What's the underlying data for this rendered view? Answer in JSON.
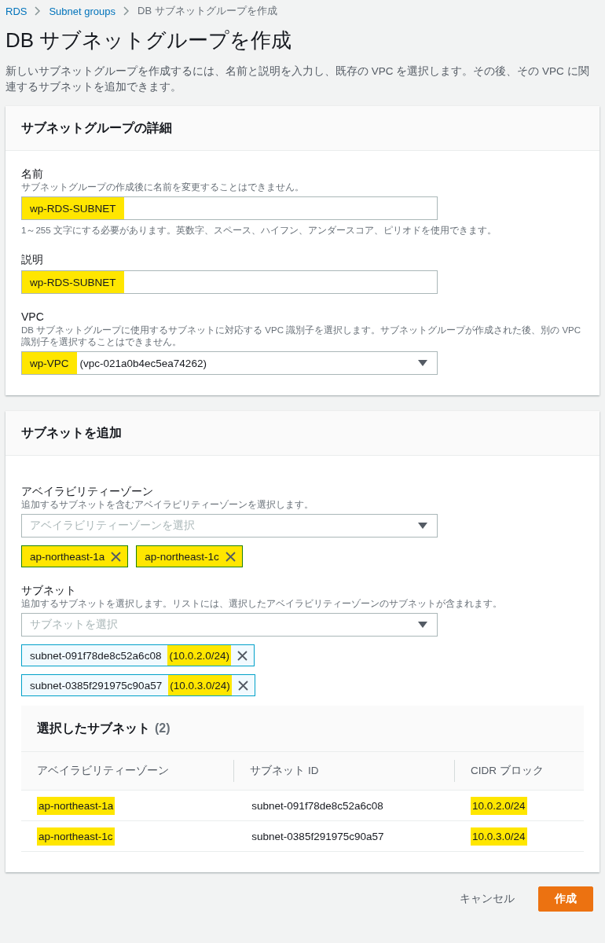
{
  "breadcrumb": [
    {
      "label": "RDS",
      "link": true
    },
    {
      "label": "Subnet groups",
      "link": true
    },
    {
      "label": "DB サブネットグループを作成",
      "link": false
    }
  ],
  "title": "DB サブネットグループを作成",
  "description": "新しいサブネットグループを作成するには、名前と説明を入力し、既存の VPC を選択します。その後、その VPC に関連するサブネットを追加できます。",
  "details": {
    "title": "サブネットグループの詳細",
    "fields": [
      {
        "kind": "text",
        "label": "名前",
        "help": "サブネットグループの作成後に名前を変更することはできません。",
        "value": "wp-RDS-SUBNET",
        "highlighted": true,
        "constraint": "1～255 文字にする必要があります。英数字、スペース、ハイフン、アンダースコア、ピリオドを使用できます。"
      },
      {
        "kind": "text",
        "label": "説明",
        "value": "wp-RDS-SUBNET",
        "highlighted": true
      },
      {
        "kind": "select",
        "label": "VPC",
        "help": "DB サブネットグループに使用するサブネットに対応する VPC 識別子を選択します。サブネットグループが作成された後、別の VPC 識別子を選択することはできません。",
        "value": "wp-VPC",
        "highlighted": true,
        "detail": "(vpc-021a0b4ec5ea74262)"
      }
    ]
  },
  "add_subnets": {
    "title": "サブネットを追加",
    "zone": {
      "label": "アベイラビリティーゾーン",
      "help": "追加するサブネットを含むアベイラビリティーゾーンを選択します。",
      "placeholder": "アベイラビリティーゾーンを選択",
      "tokens": [
        {
          "label": "ap-northeast-1a",
          "highlighted": true
        },
        {
          "label": "ap-northeast-1c",
          "highlighted": true
        }
      ]
    },
    "subnet": {
      "label": "サブネット",
      "help": "追加するサブネットを選択します。リストには、選択したアベイラビリティーゾーンのサブネットが含まれます。",
      "placeholder": "サブネットを選択",
      "tokens": [
        {
          "label": "subnet-091f78de8c52a6c08",
          "cidr": "(10.0.2.0/24)",
          "highlighted": true
        },
        {
          "label": "subnet-0385f291975c90a57",
          "cidr": "(10.0.3.0/24)",
          "highlighted": true
        }
      ]
    },
    "table": {
      "title": "選択したサブネット",
      "count": "(2)",
      "columns": [
        "アベイラビリティーゾーン",
        "サブネット ID",
        "CIDR ブロック"
      ],
      "rows": [
        {
          "zone": "ap-northeast-1a",
          "zone_highlighted": true,
          "subnet_id": "subnet-091f78de8c52a6c08",
          "cidr": "10.0.2.0/24",
          "cidr_highlighted": true
        },
        {
          "zone": "ap-northeast-1c",
          "zone_highlighted": true,
          "subnet_id": "subnet-0385f291975c90a57",
          "cidr": "10.0.3.0/24",
          "cidr_highlighted": true
        }
      ]
    }
  },
  "buttons": {
    "cancel": "キャンセル",
    "create": "作成"
  }
}
